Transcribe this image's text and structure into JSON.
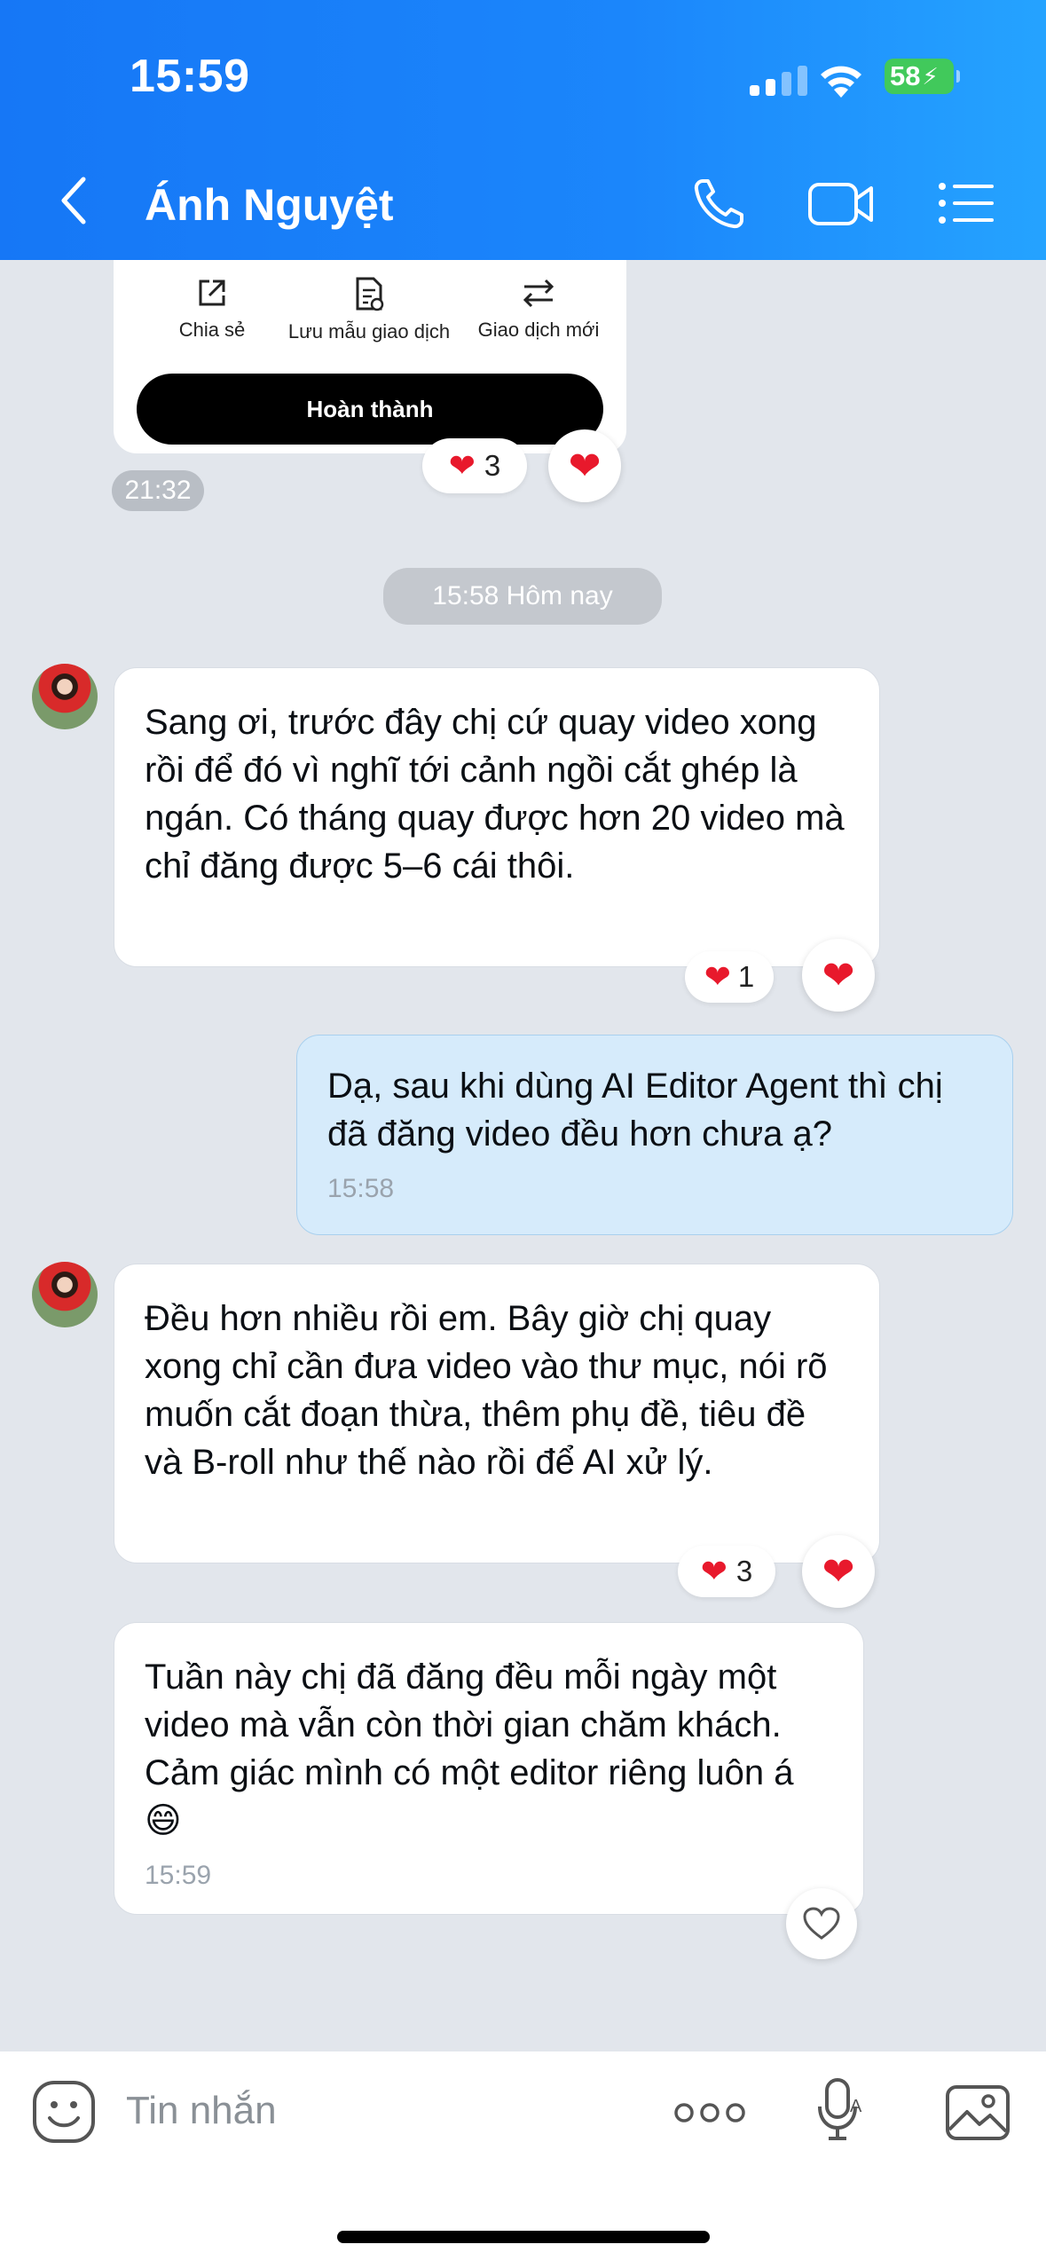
{
  "status_bar": {
    "time": "15:59",
    "battery": "58"
  },
  "header": {
    "title": "Ánh Nguyệt"
  },
  "receipt_card": {
    "actions": [
      {
        "label": "Chia sẻ"
      },
      {
        "label": "Lưu mẫu giao dịch"
      },
      {
        "label": "Giao dịch mới"
      }
    ],
    "done_label": "Hoàn thành",
    "reaction_count": "3",
    "time": "21:32"
  },
  "date_divider": "15:58 Hôm nay",
  "messages": [
    {
      "sender": "other",
      "text": "Sang ơi, trước đây chị cứ quay video xong rồi để đó vì nghĩ tới cảnh ngồi cắt ghép là ngán. Có tháng quay được hơn 20 video mà chỉ đăng được 5–6 cái thôi.",
      "reaction_count": "1"
    },
    {
      "sender": "me",
      "text": "Dạ, sau khi dùng AI Editor Agent thì chị đã đăng video đều hơn chưa ạ?",
      "time": "15:58"
    },
    {
      "sender": "other",
      "text": "Đều hơn nhiều rồi em. Bây giờ chị quay xong chỉ cần đưa video vào thư mục, nói rõ muốn cắt đoạn thừa, thêm phụ đề, tiêu đề và B-roll như thế nào rồi để AI xử lý.",
      "reaction_count": "3"
    },
    {
      "sender": "other",
      "text": "Tuần này chị đã đăng đều mỗi ngày một video mà vẫn còn thời gian chăm khách. Cảm giác mình có một editor riêng luôn á 😄",
      "time": "15:59"
    }
  ],
  "input": {
    "placeholder": "Tin nhắn"
  },
  "colors": {
    "header_blue": "#1a82fa",
    "my_bubble": "#d6ebfb",
    "heart_red": "#e8192c"
  }
}
